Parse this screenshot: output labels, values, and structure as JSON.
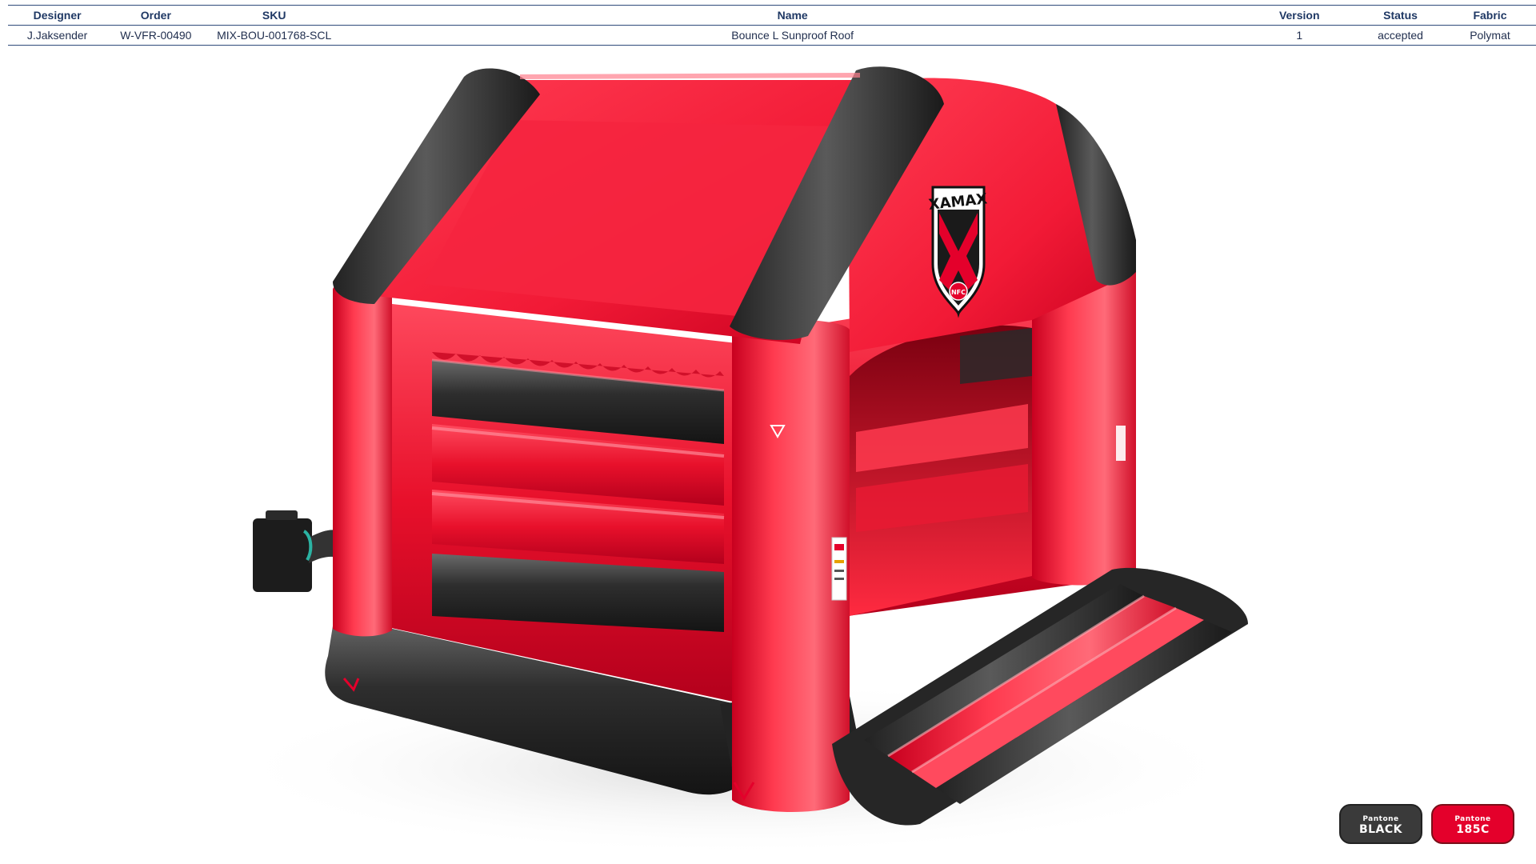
{
  "table": {
    "headers": [
      "Designer",
      "Order",
      "SKU",
      "Name",
      "Version",
      "Status",
      "Fabric"
    ],
    "row": [
      "J.Jaksender",
      "W-VFR-00490",
      "MIX-BOU-001768-SCL",
      "Bounce L Sunproof Roof",
      "1",
      "accepted",
      "Polymat"
    ]
  },
  "logo": {
    "text": "XAMAX",
    "sub": "NFC"
  },
  "swatches": [
    {
      "brand": "Pantone",
      "code": "BLACK",
      "color": "#3a3a3a"
    },
    {
      "brand": "Pantone",
      "code": "185C",
      "color": "#e4002b"
    }
  ],
  "colors": {
    "header_text": "#1f3864",
    "rule": "#2f4a7a",
    "red": "#e4002b",
    "black": "#2d2d2d"
  }
}
